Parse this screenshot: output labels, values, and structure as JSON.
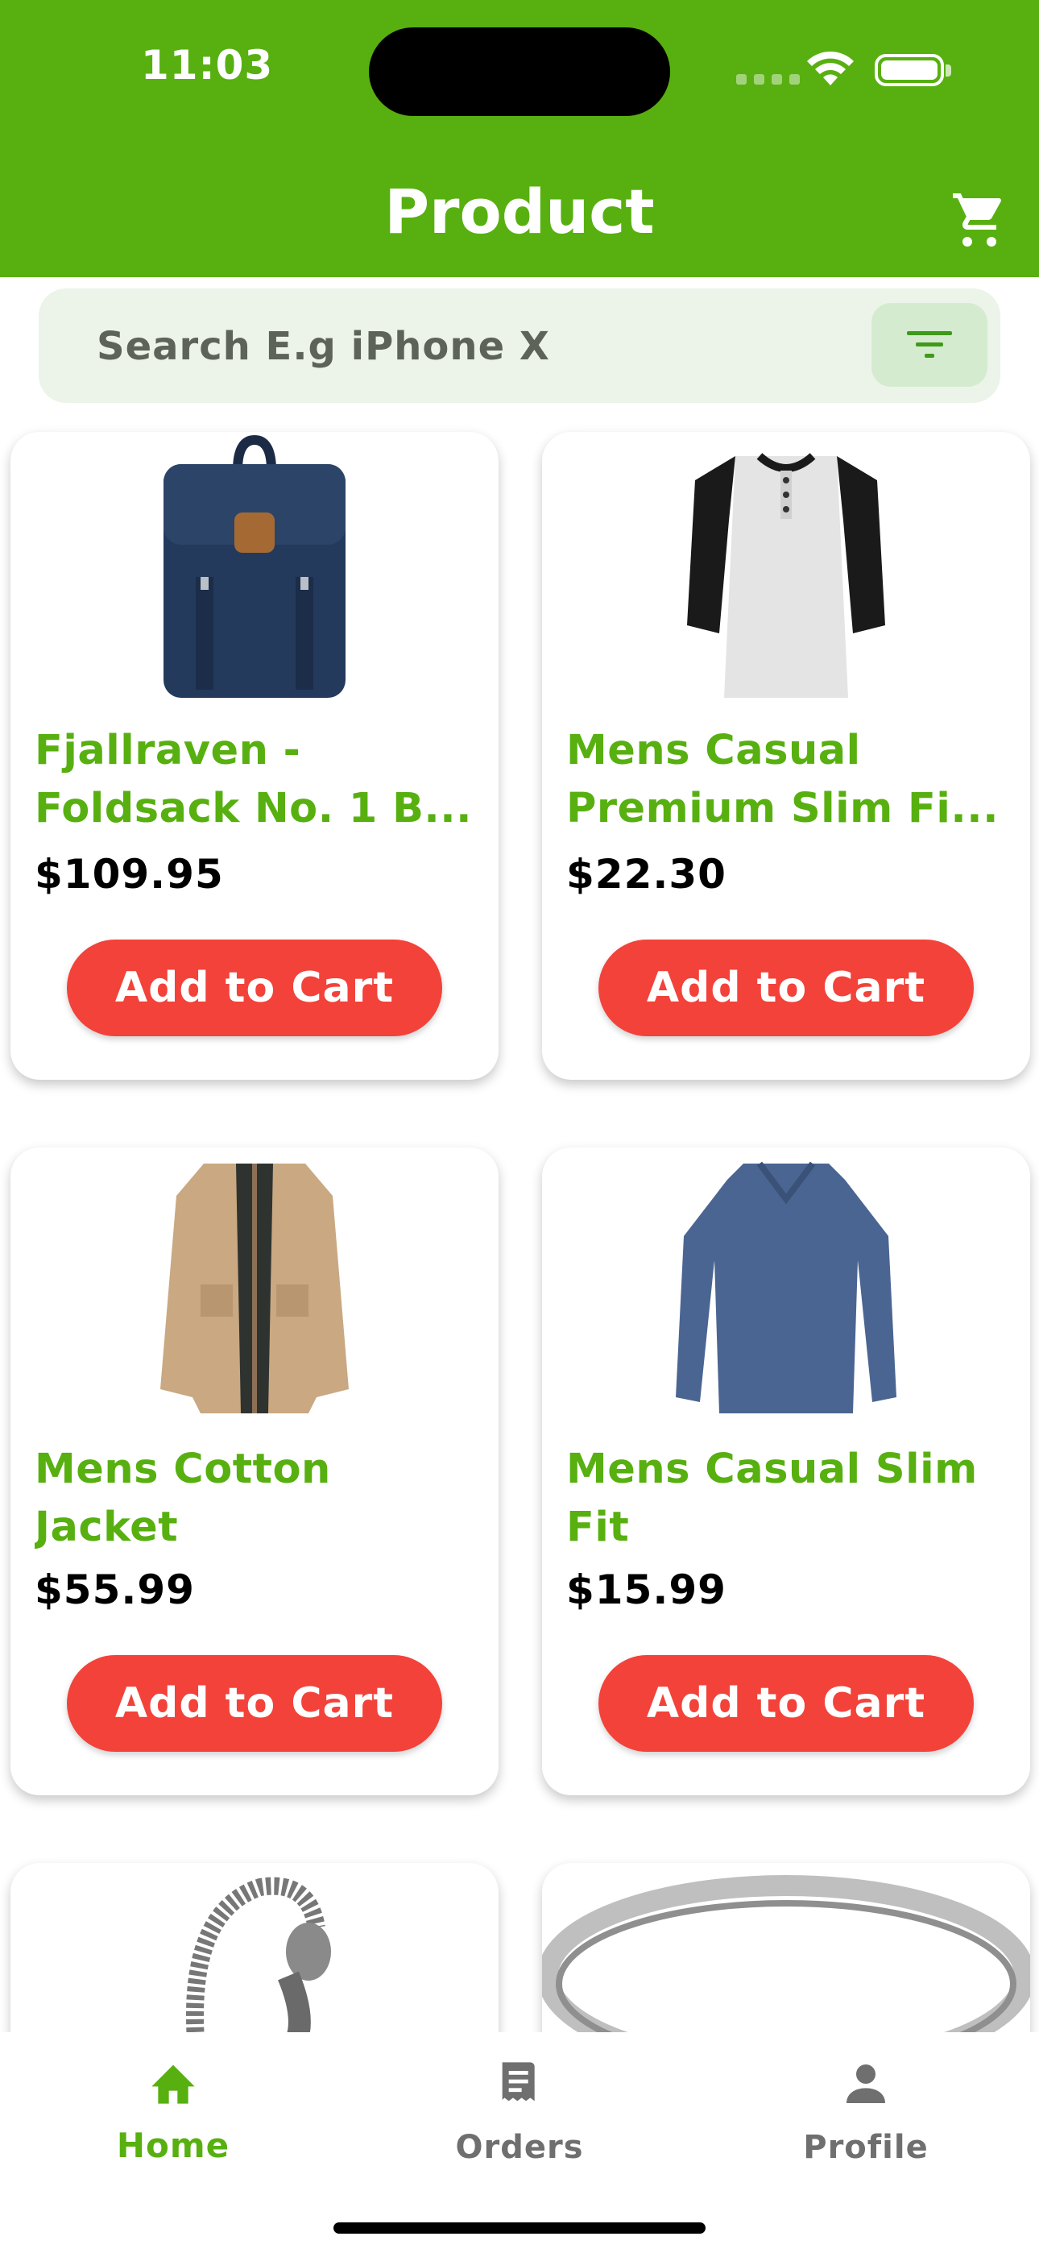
{
  "status_bar": {
    "time": "11:03"
  },
  "header": {
    "title": "Product"
  },
  "search": {
    "placeholder": "Search E.g iPhone X"
  },
  "products": [
    {
      "name": "Fjallraven - Foldsack No. 1 B...",
      "price": "$109.95",
      "button": "Add to Cart",
      "image": "backpack"
    },
    {
      "name": "Mens Casual Premium Slim Fi...",
      "price": "$22.30",
      "button": "Add to Cart",
      "image": "raglan-tshirt"
    },
    {
      "name": "Mens Cotton Jacket",
      "price": "$55.99",
      "button": "Add to Cart",
      "image": "jacket"
    },
    {
      "name": "Mens Casual Slim Fit",
      "price": "$15.99",
      "button": "Add to Cart",
      "image": "long-sleeve-tee"
    },
    {
      "name": "",
      "price": "",
      "button": "",
      "image": "bracelet"
    },
    {
      "name": "",
      "price": "",
      "button": "",
      "image": "ring"
    }
  ],
  "tabs": [
    {
      "label": "Home",
      "icon": "home-icon",
      "active": true
    },
    {
      "label": "Orders",
      "icon": "orders-icon",
      "active": false
    },
    {
      "label": "Profile",
      "icon": "profile-icon",
      "active": false
    }
  ],
  "colors": {
    "primary": "#57b010",
    "button": "#f2423a",
    "inactive": "#6f6f6f"
  }
}
